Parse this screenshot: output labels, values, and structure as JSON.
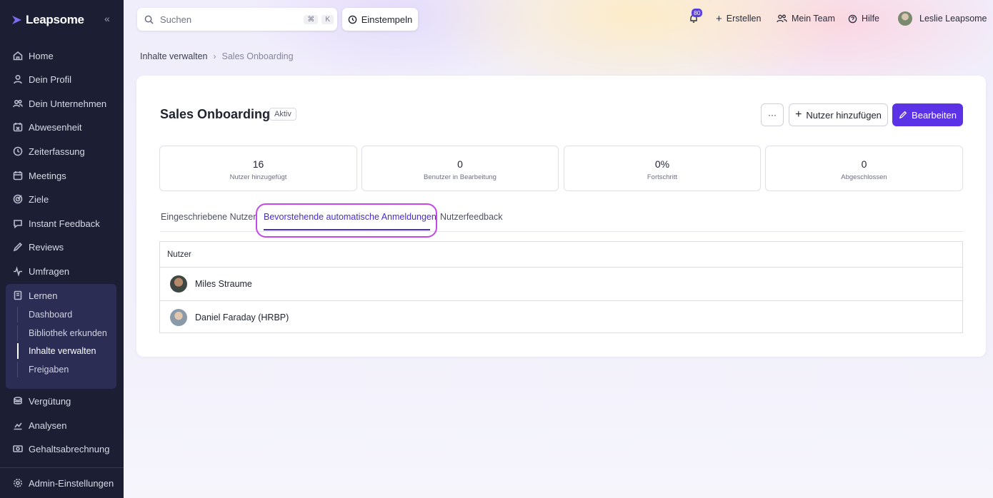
{
  "app": {
    "brand": "Leapsome"
  },
  "sidebar": {
    "items": [
      {
        "label": "Home",
        "icon": "home-icon"
      },
      {
        "label": "Dein Profil",
        "icon": "user-icon"
      },
      {
        "label": "Dein Unternehmen",
        "icon": "users-icon"
      },
      {
        "label": "Abwesenheit",
        "icon": "calendar-x-icon"
      },
      {
        "label": "Zeiterfassung",
        "icon": "clock-icon"
      },
      {
        "label": "Meetings",
        "icon": "calendar-icon"
      },
      {
        "label": "Ziele",
        "icon": "target-icon"
      },
      {
        "label": "Instant Feedback",
        "icon": "chat-icon"
      },
      {
        "label": "Reviews",
        "icon": "pen-icon"
      },
      {
        "label": "Umfragen",
        "icon": "pulse-icon"
      }
    ],
    "learning": {
      "label": "Lernen",
      "sub": [
        "Dashboard",
        "Bibliothek erkunden",
        "Inhalte verwalten",
        "Freigaben"
      ]
    },
    "bottom_items": [
      {
        "label": "Vergütung",
        "icon": "coins-icon"
      },
      {
        "label": "Analysen",
        "icon": "chart-icon"
      },
      {
        "label": "Gehaltsabrechnung",
        "icon": "money-icon"
      }
    ],
    "admin": "Admin-Einstellungen"
  },
  "topbar": {
    "search_placeholder": "Suchen",
    "shortcut_1": "⌘",
    "shortcut_2": "K",
    "clockin": "Einstempeln",
    "notifications": "80",
    "create": "Erstellen",
    "my_team": "Mein Team",
    "help": "Hilfe",
    "user": "Leslie Leapsome"
  },
  "breadcrumb": {
    "parent": "Inhalte verwalten",
    "current": "Sales Onboarding"
  },
  "page": {
    "title": "Sales Onboarding",
    "status": "Aktiv",
    "more": "···",
    "add_users": "Nutzer hinzufügen",
    "edit": "Bearbeiten"
  },
  "stats": [
    {
      "value": "16",
      "label": "Nutzer hinzugefügt"
    },
    {
      "value": "0",
      "label": "Benutzer in Bearbeitung"
    },
    {
      "value": "0%",
      "label": "Fortschritt"
    },
    {
      "value": "0",
      "label": "Abgeschlossen"
    }
  ],
  "tabs": [
    "Eingeschriebene Nutzer",
    "Bevorstehende automatische Anmeldungen",
    "Nutzerfeedback"
  ],
  "table": {
    "header": "Nutzer",
    "rows": [
      "Miles Straume",
      "Daniel Faraday (HRBP)"
    ]
  },
  "colors": {
    "sidebar": "#1c1f33",
    "accent": "#5b32e6",
    "highlight": "#c548e8"
  }
}
